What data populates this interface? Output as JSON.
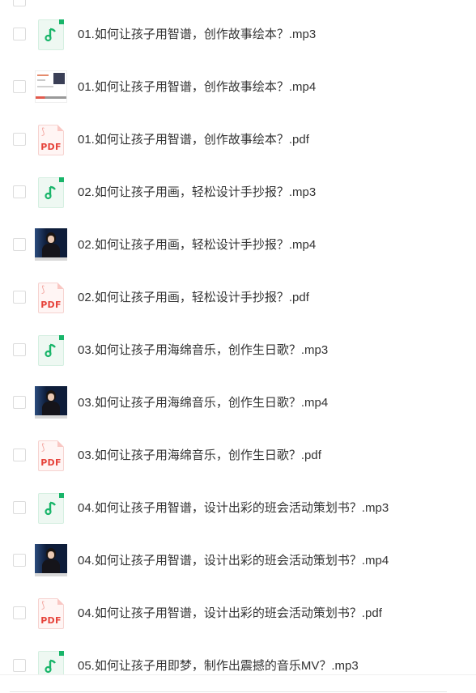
{
  "files": [
    {
      "name": "01.如何让孩子用智谱，创作故事绘本？.mp3",
      "type": "audio",
      "icon": "audio-file-icon"
    },
    {
      "name": "01.如何让孩子用智谱，创作故事绘本？.mp4",
      "type": "video-slide",
      "icon": "video-thumbnail"
    },
    {
      "name": "01.如何让孩子用智谱，创作故事绘本？.pdf",
      "type": "pdf",
      "icon": "pdf-file-icon",
      "badge": "PDF"
    },
    {
      "name": "02.如何让孩子用画，轻松设计手抄报？.mp3",
      "type": "audio",
      "icon": "audio-file-icon"
    },
    {
      "name": "02.如何让孩子用画，轻松设计手抄报？.mp4",
      "type": "video",
      "icon": "video-thumbnail"
    },
    {
      "name": "02.如何让孩子用画，轻松设计手抄报？.pdf",
      "type": "pdf",
      "icon": "pdf-file-icon",
      "badge": "PDF"
    },
    {
      "name": "03.如何让孩子用海绵音乐，创作生日歌？.mp3",
      "type": "audio",
      "icon": "audio-file-icon"
    },
    {
      "name": "03.如何让孩子用海绵音乐，创作生日歌？.mp4",
      "type": "video",
      "icon": "video-thumbnail"
    },
    {
      "name": "03.如何让孩子用海绵音乐，创作生日歌？.pdf",
      "type": "pdf",
      "icon": "pdf-file-icon",
      "badge": "PDF"
    },
    {
      "name": "04.如何让孩子用智谱，设计出彩的班会活动策划书？.mp3",
      "type": "audio",
      "icon": "audio-file-icon"
    },
    {
      "name": "04.如何让孩子用智谱，设计出彩的班会活动策划书？.mp4",
      "type": "video",
      "icon": "video-thumbnail"
    },
    {
      "name": "04.如何让孩子用智谱，设计出彩的班会活动策划书？.pdf",
      "type": "pdf",
      "icon": "pdf-file-icon",
      "badge": "PDF"
    },
    {
      "name": "05.如何让孩子用即梦，制作出震撼的音乐MV？.mp3",
      "type": "audio",
      "icon": "audio-file-icon"
    }
  ],
  "colors": {
    "audio_accent": "#19b56a",
    "pdf_accent": "#e6433b",
    "text": "#333333",
    "checkbox_border": "#dcdcdc"
  }
}
